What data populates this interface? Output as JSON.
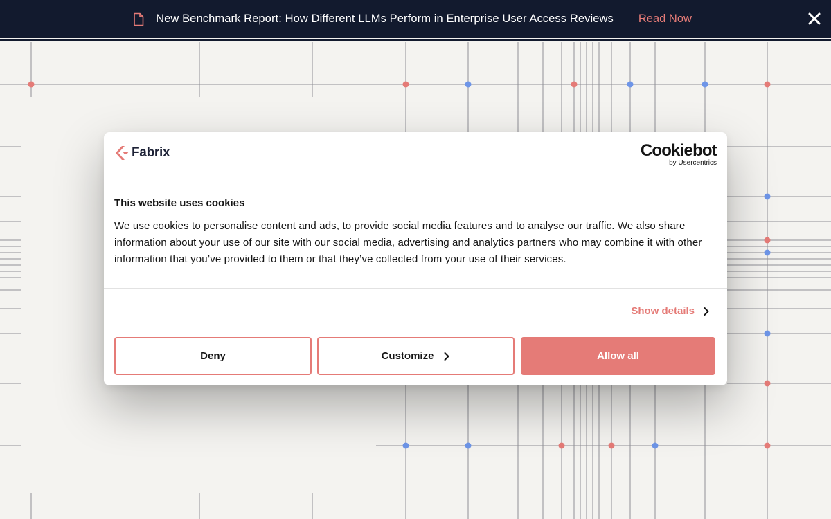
{
  "banner": {
    "icon": "document-icon",
    "text": "New Benchmark Report: How Different LLMs Perform in Enterprise User Access Reviews",
    "link_label": "Read Now",
    "close_icon": "close-icon",
    "background": "#121a2e",
    "link_color": "#e57b77"
  },
  "dialog": {
    "brand_name": "Fabrix",
    "provider_name": "Cookiebot",
    "provider_sub": "by Usercentrics",
    "title": "This website uses cookies",
    "description": "We use cookies to personalise content and ads, to provide social media features and to analyse our traffic. We also share information about your use of our site with our social media, advertising and analytics partners who may combine it with other information that you’ve provided to them or that they’ve collected from your use of their services.",
    "show_details_label": "Show details",
    "buttons": {
      "deny": "Deny",
      "customize": "Customize",
      "allow_all": "Allow all"
    },
    "accent": "#e57b77"
  },
  "background": {
    "grid_dot_colors": [
      "#e57b77",
      "#6e95e8"
    ]
  }
}
